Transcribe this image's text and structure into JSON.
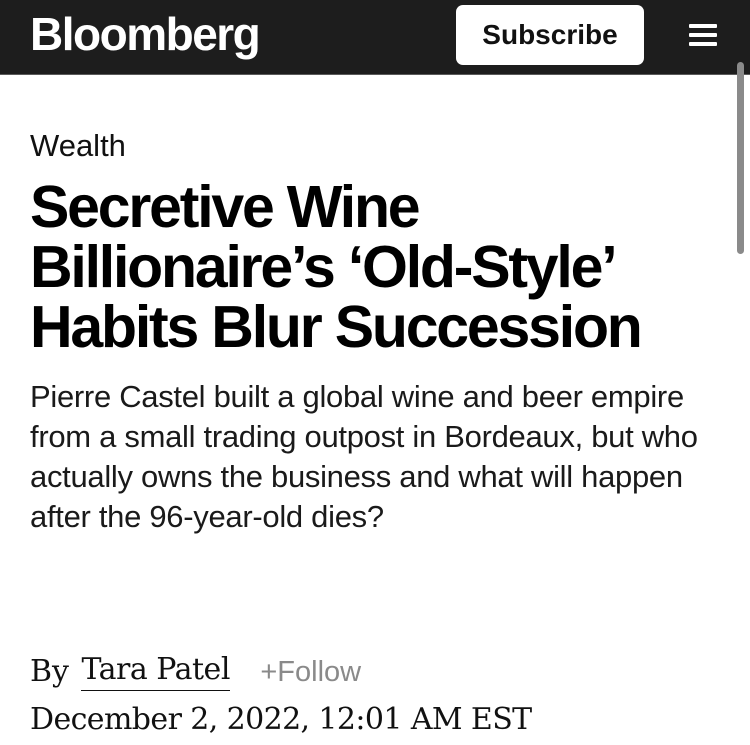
{
  "header": {
    "logo_text": "Bloomberg",
    "subscribe_label": "Subscribe",
    "menu_icon": "hamburger-menu-icon",
    "background_color": "#1d1d1d",
    "button_color": "#ffffff"
  },
  "article": {
    "section": "Wealth",
    "headline": "Secretive Wine Billionaire’s ‘Old-Style’ Habits Blur Succession",
    "dek": "Pierre Castel built a global wine and beer empire from a small trading outpost in Bordeaux, but who actually owns the business and what will happen after the 96-year-old dies?",
    "byline": {
      "prefix": "By",
      "author": "Tara Patel",
      "follow_label": "+Follow"
    },
    "date": "December 2, 2022, 12:01 AM EST"
  },
  "colors": {
    "text": "#000000",
    "muted": "#8a8a8a"
  }
}
